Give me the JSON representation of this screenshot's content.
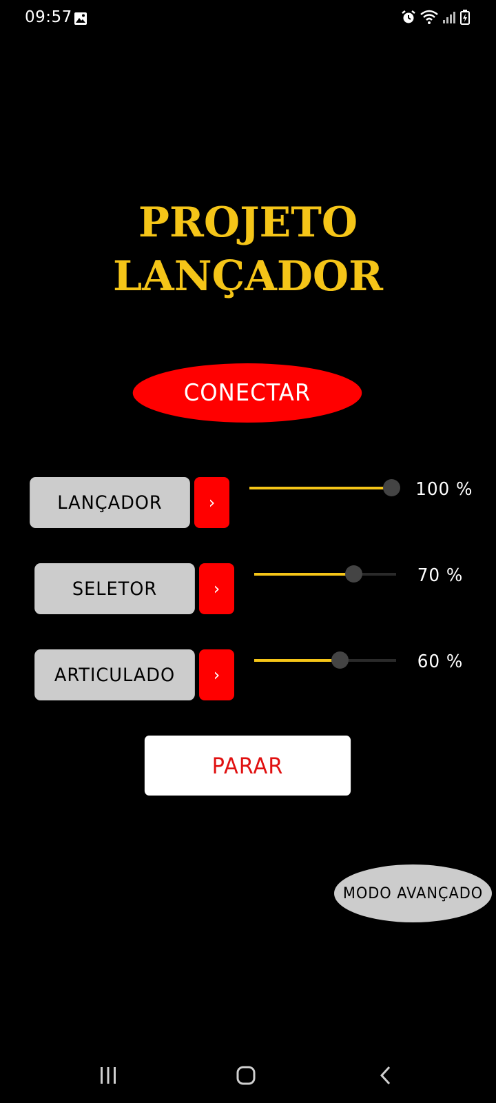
{
  "status_bar": {
    "time": "09:57",
    "left_icons": [
      "gallery-icon"
    ],
    "right_icons": [
      "alarm-icon",
      "wifi-icon",
      "signal-icon",
      "battery-charging-icon"
    ]
  },
  "title": {
    "line1": "PROJETO",
    "line2": "LANÇADOR",
    "color": "#f5c518"
  },
  "connect_button": {
    "label": "CONECTAR",
    "color": "#ff0000"
  },
  "controls": [
    {
      "label": "LANÇADOR",
      "arrow": "›",
      "value": 100,
      "value_text": "100 %"
    },
    {
      "label": "SELETOR",
      "arrow": "›",
      "value": 70,
      "value_text": "70 %"
    },
    {
      "label": "ARTICULADO",
      "arrow": "›",
      "value": 60,
      "value_text": "60 %"
    }
  ],
  "stop_button": {
    "label": "PARAR",
    "color": "#e01010"
  },
  "advanced_button": {
    "label": "MODO AVANÇADO"
  },
  "nav_bar": {
    "icons": [
      "recent-apps-icon",
      "home-icon",
      "back-icon"
    ]
  }
}
